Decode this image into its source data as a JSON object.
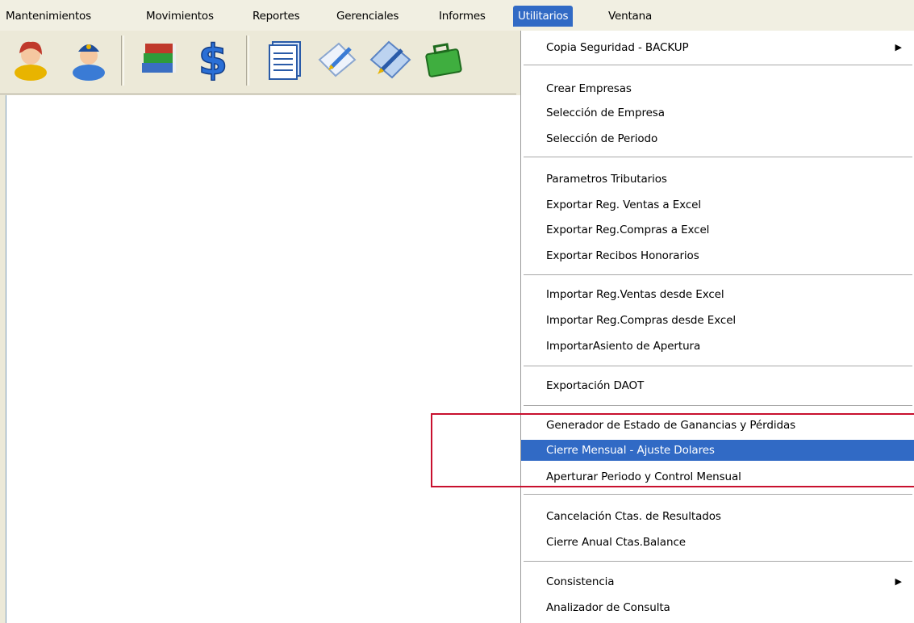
{
  "menubar": {
    "items": [
      {
        "label": "Mantenimientos"
      },
      {
        "label": "Movimientos"
      },
      {
        "label": "Reportes"
      },
      {
        "label": "Gerenciales"
      },
      {
        "label": "Informes"
      },
      {
        "label": "Utilitarios",
        "active": true
      },
      {
        "label": "Ventana"
      }
    ]
  },
  "toolbar": {
    "icons": [
      "user-female-icon",
      "user-male-icon",
      "books-icon",
      "dollar-icon",
      "document-list-icon",
      "edit-document-icon",
      "pencil-book-icon",
      "briefcase-icon"
    ]
  },
  "dropdown": {
    "items": [
      {
        "label": "Copia Seguridad - BACKUP",
        "submenu": true
      },
      {
        "label": "Crear Empresas"
      },
      {
        "label": "Selección de Empresa"
      },
      {
        "label": "Selección de Periodo"
      },
      {
        "label": "Parametros Tributarios"
      },
      {
        "label": "Exportar Reg. Ventas a Excel"
      },
      {
        "label": "Exportar Reg.Compras a Excel"
      },
      {
        "label": "Exportar Recibos Honorarios"
      },
      {
        "label": "Importar Reg.Ventas desde Excel"
      },
      {
        "label": "Importar Reg.Compras desde Excel"
      },
      {
        "label": "ImportarAsiento de  Apertura"
      },
      {
        "label": "Exportación DAOT"
      },
      {
        "label": "Generador de Estado de Ganancias y Pérdidas"
      },
      {
        "label": "Cierre Mensual - Ajuste Dolares",
        "highlighted": true
      },
      {
        "label": "Aperturar Periodo y Control Mensual"
      },
      {
        "label": "Cancelación Ctas. de Resultados"
      },
      {
        "label": "Cierre Anual Ctas.Balance"
      },
      {
        "label": "Consistencia",
        "submenu": true
      },
      {
        "label": "Analizador de Consulta"
      }
    ],
    "submenu_arrow": "▶"
  },
  "colors": {
    "highlight": "#316ac5",
    "annotation": "#c8102e"
  }
}
